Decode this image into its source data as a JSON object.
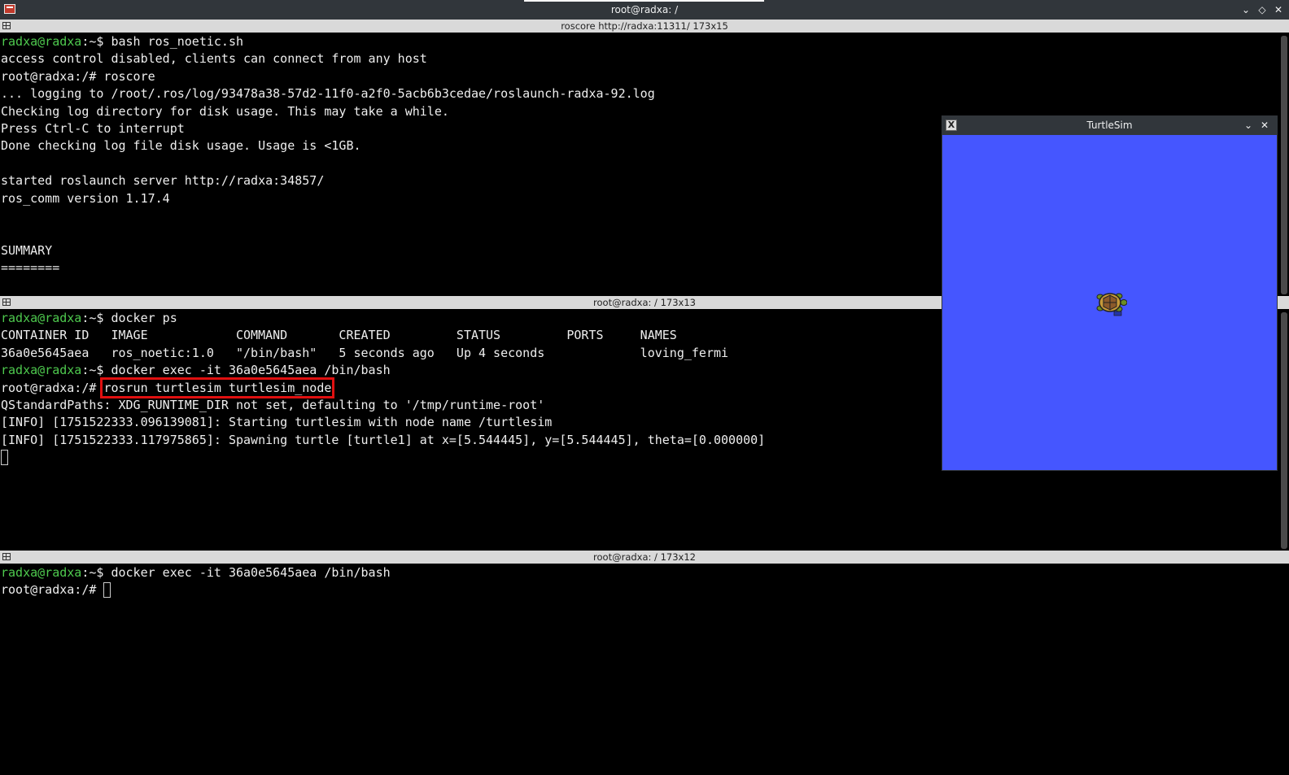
{
  "window": {
    "title": "root@radxa: /",
    "buttons": [
      "⌄",
      "◇",
      "✕"
    ]
  },
  "panes": [
    {
      "bar_title": "roscore http://radxa:11311/ 173x15",
      "lines": [
        {
          "user": "radxa@radxa",
          "rest": ":~$ bash ros_noetic.sh"
        },
        {
          "text": "access control disabled, clients can connect from any host"
        },
        {
          "text": "root@radxa:/# roscore"
        },
        {
          "text": "... logging to /root/.ros/log/93478a38-57d2-11f0-a2f0-5acb6b3cedae/roslaunch-radxa-92.log"
        },
        {
          "text": "Checking log directory for disk usage. This may take a while."
        },
        {
          "text": "Press Ctrl-C to interrupt"
        },
        {
          "text": "Done checking log file disk usage. Usage is <1GB."
        },
        {
          "text": ""
        },
        {
          "text": "started roslaunch server http://radxa:34857/"
        },
        {
          "text": "ros_comm version 1.17.4"
        },
        {
          "text": ""
        },
        {
          "text": ""
        },
        {
          "text": "SUMMARY"
        },
        {
          "text": "========"
        }
      ]
    },
    {
      "bar_title": "root@radxa: / 173x13",
      "lines": [
        {
          "user": "radxa@radxa",
          "rest": ":~$ docker ps"
        },
        {
          "text": "CONTAINER ID   IMAGE            COMMAND       CREATED         STATUS         PORTS     NAMES"
        },
        {
          "text": "36a0e5645aea   ros_noetic:1.0   \"/bin/bash\"   5 seconds ago   Up 4 seconds             loving_fermi"
        },
        {
          "user": "radxa@radxa",
          "rest": ":~$ docker exec -it 36a0e5645aea /bin/bash"
        },
        {
          "prefix": "root@radxa:/# ",
          "highlight": "rosrun turtlesim turtlesim_node"
        },
        {
          "text": "QStandardPaths: XDG_RUNTIME_DIR not set, defaulting to '/tmp/runtime-root'"
        },
        {
          "text": "[INFO] [1751522333.096139081]: Starting turtlesim with node name /turtlesim"
        },
        {
          "text": "[INFO] [1751522333.117975865]: Spawning turtle [turtle1] at x=[5.544445], y=[5.544445], theta=[0.000000]"
        }
      ]
    },
    {
      "bar_title": "root@radxa: / 173x12",
      "lines": [
        {
          "user": "radxa@radxa",
          "rest": ":~$ docker exec -it 36a0e5645aea /bin/bash"
        },
        {
          "prefix": "root@radxa:/# "
        }
      ]
    }
  ],
  "turtlesim": {
    "title": "TurtleSim",
    "x_icon": "X",
    "buttons": [
      "⌄",
      "✕"
    ],
    "background": "#4556ff"
  }
}
